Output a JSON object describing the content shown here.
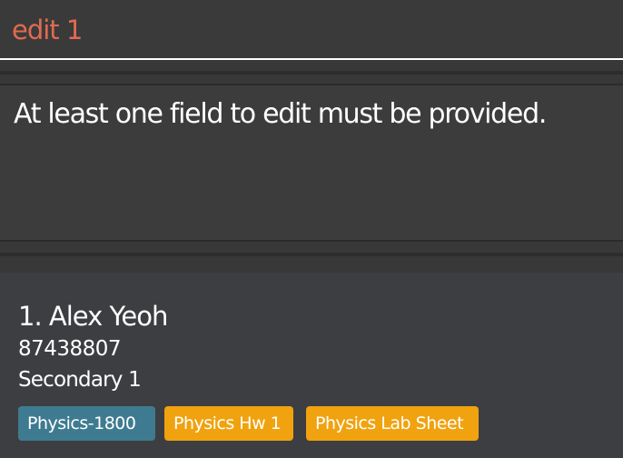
{
  "command_box": {
    "value": "edit 1"
  },
  "result": {
    "message": "At least one field to edit must be provided."
  },
  "person_list": [
    {
      "name": "1. Alex Yeoh",
      "phone": "87438807",
      "level": "Secondary 1",
      "tags": [
        {
          "label": "Physics-1800",
          "color": "#3e7b91"
        },
        {
          "label": "Physics Hw 1",
          "color": "#f0a20f"
        },
        {
          "label": "Physics Lab Sheet",
          "color": "#f0a20f"
        }
      ]
    }
  ]
}
